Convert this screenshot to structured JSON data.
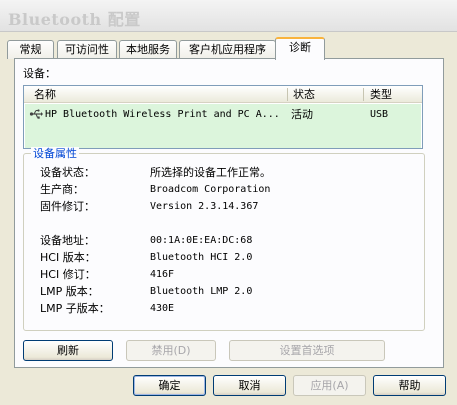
{
  "window": {
    "title": "Bluetooth 配置"
  },
  "tabs": [
    {
      "label": "常规"
    },
    {
      "label": "可访问性"
    },
    {
      "label": "本地服务"
    },
    {
      "label": "客户机应用程序"
    },
    {
      "label": "诊断",
      "active": true
    }
  ],
  "devices": {
    "label": "设备：",
    "columns": {
      "name": "名称",
      "status": "状态",
      "type": "类型"
    },
    "rows": [
      {
        "name": "HP Bluetooth Wireless Print and PC A...",
        "status": "活动",
        "type": "USB",
        "icon": "usb-icon"
      }
    ]
  },
  "properties": {
    "legend": "设备属性",
    "items": [
      {
        "label": "设备状态：",
        "value": "所选择的设备工作正常。"
      },
      {
        "label": "生产商：",
        "value": "Broadcom Corporation"
      },
      {
        "label": "固件修订：",
        "value": "Version 2.3.14.367"
      },
      {
        "label": "设备地址：",
        "value": "00:1A:0E:EA:DC:68"
      },
      {
        "label": "HCI 版本：",
        "value": "Bluetooth HCI 2.0"
      },
      {
        "label": "HCI 修订：",
        "value": "416F"
      },
      {
        "label": "LMP 版本：",
        "value": "Bluetooth LMP 2.0"
      },
      {
        "label": "LMP 子版本：",
        "value": "430E"
      }
    ]
  },
  "panel_buttons": {
    "refresh": "刷新",
    "disable": "禁用(D)",
    "preferences": "设置首选项"
  },
  "dialog_buttons": {
    "ok": "确定",
    "cancel": "取消",
    "apply": "应用(A)",
    "help": "帮助"
  },
  "colors": {
    "tab_highlight": "#f9b33c",
    "selected_row": "#dcf5dc",
    "legend_text": "#0046d5",
    "button_border": "#003c74"
  }
}
